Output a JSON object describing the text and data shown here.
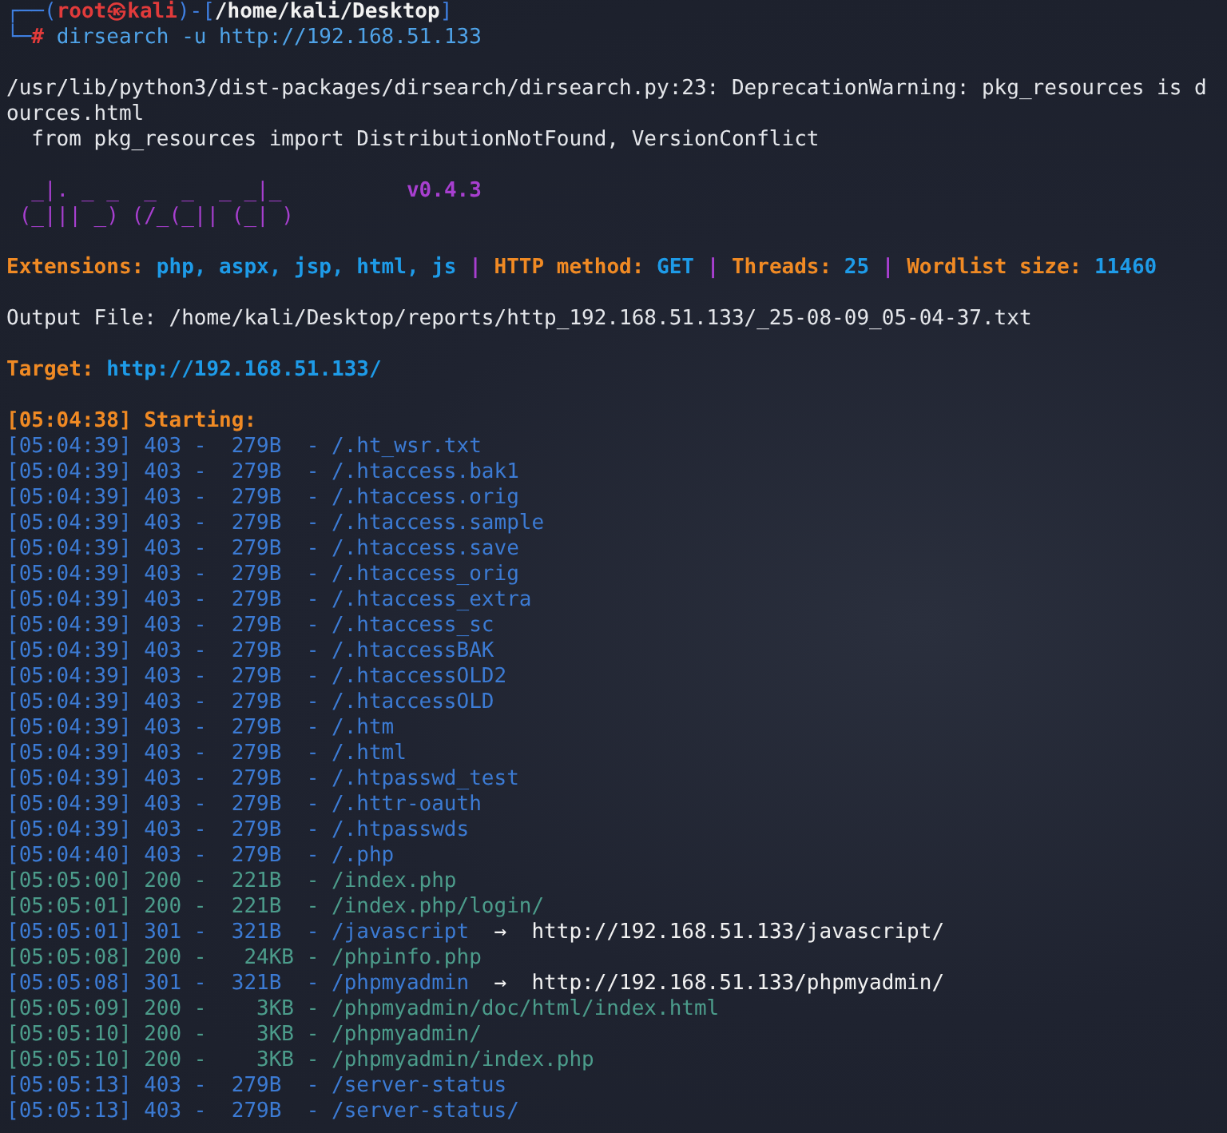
{
  "prompt": {
    "corner_top": "┌──(",
    "user_host": "root㉿kali",
    "middle": ")-[",
    "path": "/home/kali/Desktop",
    "close": "]",
    "corner_bottom": "└─",
    "symbol": "#",
    "command": "dirsearch -u http://192.168.51.133"
  },
  "warning": [
    "/usr/lib/python3/dist-packages/dirsearch/dirsearch.py:23: DeprecationWarning: pkg_resources is d",
    "ources.html",
    "  from pkg_resources import DistributionNotFound, VersionConflict"
  ],
  "banner": {
    "logo": [
      "  _|. _ _  _  _  _ _|_",
      "(_||| _) (/_(_|| (_| )"
    ],
    "version": "v0.4.3"
  },
  "config": [
    {
      "label": "Extensions:",
      "value": "php, aspx, jsp, html, js"
    },
    {
      "separator": "|",
      "label": "HTTP method:",
      "value": "GET"
    },
    {
      "separator": "|",
      "label": "Threads:",
      "value": "25"
    },
    {
      "separator": "|",
      "label": "Wordlist size:",
      "value": "11460"
    }
  ],
  "output_file": "Output File: /home/kali/Desktop/reports/http_192.168.51.133/_25-08-09_05-04-37.txt",
  "target": {
    "label": "Target:",
    "value": "http://192.168.51.133/"
  },
  "starting": "[05:04:38] Starting:",
  "results": [
    {
      "kind": "forbidden",
      "text": "[05:04:39] 403 -  279B  - /.ht_wsr.txt"
    },
    {
      "kind": "forbidden",
      "text": "[05:04:39] 403 -  279B  - /.htaccess.bak1"
    },
    {
      "kind": "forbidden",
      "text": "[05:04:39] 403 -  279B  - /.htaccess.orig"
    },
    {
      "kind": "forbidden",
      "text": "[05:04:39] 403 -  279B  - /.htaccess.sample"
    },
    {
      "kind": "forbidden",
      "text": "[05:04:39] 403 -  279B  - /.htaccess.save"
    },
    {
      "kind": "forbidden",
      "text": "[05:04:39] 403 -  279B  - /.htaccess_orig"
    },
    {
      "kind": "forbidden",
      "text": "[05:04:39] 403 -  279B  - /.htaccess_extra"
    },
    {
      "kind": "forbidden",
      "text": "[05:04:39] 403 -  279B  - /.htaccess_sc"
    },
    {
      "kind": "forbidden",
      "text": "[05:04:39] 403 -  279B  - /.htaccessBAK"
    },
    {
      "kind": "forbidden",
      "text": "[05:04:39] 403 -  279B  - /.htaccessOLD2"
    },
    {
      "kind": "forbidden",
      "text": "[05:04:39] 403 -  279B  - /.htaccessOLD"
    },
    {
      "kind": "forbidden",
      "text": "[05:04:39] 403 -  279B  - /.htm"
    },
    {
      "kind": "forbidden",
      "text": "[05:04:39] 403 -  279B  - /.html"
    },
    {
      "kind": "forbidden",
      "text": "[05:04:39] 403 -  279B  - /.htpasswd_test"
    },
    {
      "kind": "forbidden",
      "text": "[05:04:39] 403 -  279B  - /.httr-oauth"
    },
    {
      "kind": "forbidden",
      "text": "[05:04:39] 403 -  279B  - /.htpasswds"
    },
    {
      "kind": "forbidden",
      "text": "[05:04:40] 403 -  279B  - /.php"
    },
    {
      "kind": "ok",
      "text": "[05:05:00] 200 -  221B  - /index.php"
    },
    {
      "kind": "ok",
      "text": "[05:05:01] 200 -  221B  - /index.php/login/"
    },
    {
      "kind": "redirect",
      "text": "[05:05:01] 301 -  321B  - /javascript",
      "arrow": "→",
      "location": "http://192.168.51.133/javascript/"
    },
    {
      "kind": "ok",
      "text": "[05:05:08] 200 -   24KB - /phpinfo.php"
    },
    {
      "kind": "redirect",
      "text": "[05:05:08] 301 -  321B  - /phpmyadmin",
      "arrow": "→",
      "location": "http://192.168.51.133/phpmyadmin/"
    },
    {
      "kind": "ok",
      "text": "[05:05:09] 200 -    3KB - /phpmyadmin/doc/html/index.html"
    },
    {
      "kind": "ok",
      "text": "[05:05:10] 200 -    3KB - /phpmyadmin/"
    },
    {
      "kind": "ok",
      "text": "[05:05:10] 200 -    3KB - /phpmyadmin/index.php"
    },
    {
      "kind": "forbidden",
      "text": "[05:05:13] 403 -  279B  - /server-status"
    },
    {
      "kind": "forbidden",
      "text": "[05:05:13] 403 -  279B  - /server-status/"
    }
  ]
}
